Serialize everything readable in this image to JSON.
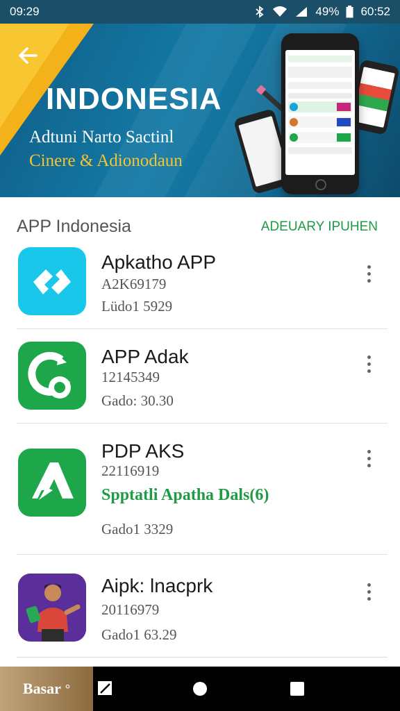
{
  "status_bar": {
    "time": "09:29",
    "battery": "49%",
    "clock_right": "60:52",
    "icons": [
      "bluetooth-icon",
      "wifi-icon",
      "signal-icon",
      "battery-icon"
    ]
  },
  "banner": {
    "title": "INDONESIA",
    "subtitle_line1": "Adtuni Narto Sactinl",
    "subtitle_line2": "Cinere & Adionodaun",
    "colors": {
      "background": "#147aa6",
      "corner": "#f3b21a",
      "subtitle2": "#f6c431"
    }
  },
  "section": {
    "title": "APP Indonesia",
    "link": "ADEUARY IPUHEN"
  },
  "apps": [
    {
      "name": "Apkatho APP",
      "id": "A2K69179",
      "meta": "Lüdo1 5929",
      "promo": "",
      "icon": "diamond-arrows-icon",
      "icon_color": "#19c7ea"
    },
    {
      "name": "APP Adak",
      "id": "12145349",
      "meta": "Gado: 30.30",
      "promo": "",
      "icon": "circle-play-icon",
      "icon_color": "#1ea64a"
    },
    {
      "name": "PDP AKS",
      "id": "22116919",
      "meta": "Gado1 3329",
      "promo": "Spptatli Apatha Dals(6)",
      "icon": "triangle-arrow-icon",
      "icon_color": "#1ea64a"
    },
    {
      "name": "Aipk: lnacprk",
      "id": "20116979",
      "meta": "Gado1 63.29",
      "promo": "",
      "icon": "person-character-icon",
      "icon_color": "#5b2f9a"
    }
  ],
  "nav_bar": {
    "brand_label": "Basar",
    "brand_suffix": "°",
    "buttons": [
      "pen-square-icon",
      "home-circle-icon",
      "recent-square-icon"
    ]
  }
}
